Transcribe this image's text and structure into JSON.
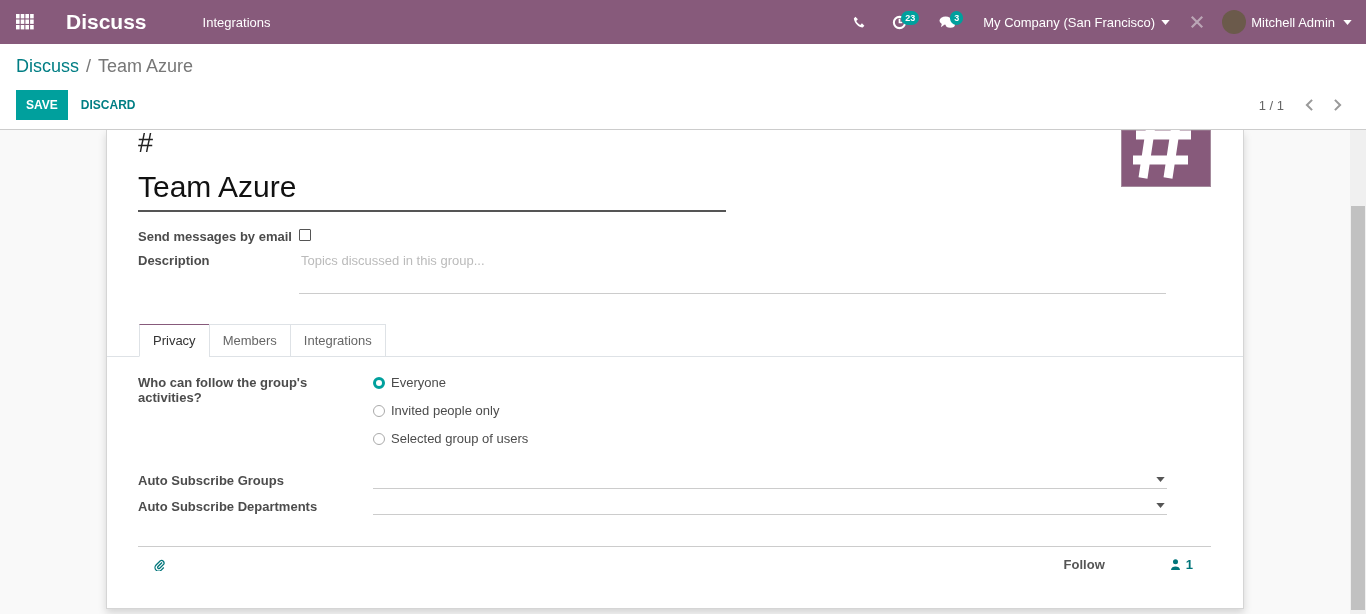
{
  "navbar": {
    "app_name": "Discuss",
    "menu": [
      "Integrations"
    ],
    "activity_count": "23",
    "message_count": "3",
    "company": "My Company (San Francisco)",
    "user": "Mitchell Admin"
  },
  "breadcrumb": {
    "parent": "Discuss",
    "separator": "/",
    "current": "Team Azure"
  },
  "buttons": {
    "save": "SAVE",
    "discard": "DISCARD"
  },
  "pager": {
    "value": "1 / 1"
  },
  "form": {
    "prefix": "#",
    "name": "Team Azure",
    "fields": [
      {
        "kind": "checkbox",
        "label": "Send messages by email",
        "checked": false
      },
      {
        "kind": "textarea",
        "label": "Description",
        "placeholder": "Topics discussed in this group..."
      }
    ]
  },
  "tabs": [
    {
      "label": "Privacy",
      "selected": true
    },
    {
      "label": "Members",
      "selected": false
    },
    {
      "label": "Integrations",
      "selected": false
    }
  ],
  "privacy": {
    "question": "Who can follow the group's activities?",
    "options": [
      {
        "label": "Everyone",
        "selected": true
      },
      {
        "label": "Invited people only",
        "selected": false
      },
      {
        "label": "Selected group of users",
        "selected": false
      }
    ],
    "selects": [
      {
        "label": "Auto Subscribe Groups"
      },
      {
        "label": "Auto Subscribe Departments"
      }
    ]
  },
  "chatter": {
    "follow": "Follow",
    "followers": "1"
  }
}
